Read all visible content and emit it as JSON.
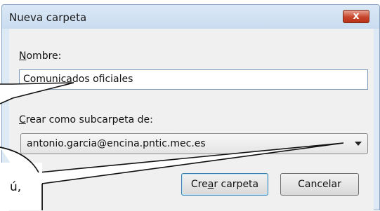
{
  "window": {
    "title": "Nueva carpeta",
    "close_label": "x"
  },
  "form": {
    "name_label": {
      "hotkey": "N",
      "rest": "ombre:"
    },
    "name_value": "Comunicados oficiales",
    "parent_label": {
      "hotkey": "C",
      "rest": "rear como subcarpeta de:"
    },
    "parent_selected": "antonio.garcia@encina.pntic.mec.es"
  },
  "buttons": {
    "create": {
      "before": "Cre",
      "hotkey": "a",
      "after": "r carpeta"
    },
    "cancel": "Cancelar"
  },
  "callout": {
    "text": "ú,"
  },
  "colors": {
    "title_bar": "#c9dcf0",
    "close": "#c7452c",
    "dialog_bg": "#f0f0f0"
  }
}
